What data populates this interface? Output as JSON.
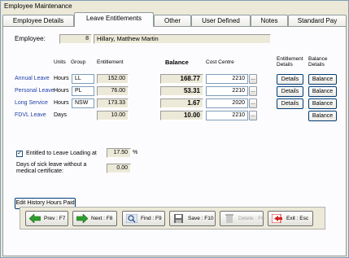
{
  "window": {
    "title": "Employee Maintenance"
  },
  "tabs": [
    "Employee Details",
    "Leave Entitlements",
    "Other",
    "User Defined",
    "Notes",
    "Standard Pay"
  ],
  "employee": {
    "label": "Employee:",
    "number": "8",
    "name": "Hillary, Matthew Martin"
  },
  "headers": {
    "units": "Units",
    "group": "Group",
    "entitlement": "Entitlement",
    "balance": "Balance",
    "cost_centre": "Cost Centre",
    "entitlement_details": "Entitlement Details",
    "balance_details": "Balance Details"
  },
  "leave_rows": [
    {
      "name": "Annual Leave",
      "units": "Hours",
      "group": "LL",
      "entitlement": "152.00",
      "balance": "168.77",
      "cost_centre": "2210",
      "details": "Details",
      "balance_btn": "Balance"
    },
    {
      "name": "Personal Leave",
      "units": "Hours",
      "group": "PL",
      "entitlement": "76.00",
      "balance": "53.31",
      "cost_centre": "2210",
      "details": "Details",
      "balance_btn": "Balance"
    },
    {
      "name": "Long Service",
      "units": "Hours",
      "group": "NSW",
      "entitlement": "173.33",
      "balance": "1.67",
      "cost_centre": "2020",
      "details": "Details",
      "balance_btn": "Balance"
    },
    {
      "name": "FDVL Leave",
      "units": "Days",
      "group": "",
      "entitlement": "10.00",
      "balance": "10.00",
      "cost_centre": "2210",
      "details": "",
      "balance_btn": "Balance"
    }
  ],
  "ellipsis": "...",
  "leave_loading": {
    "label": "Entitled to Leave Loading at",
    "value": "17.50",
    "unit": "%",
    "checked": true
  },
  "sick_leave": {
    "label_line1": "Days of sick leave without a",
    "label_line2": "medical certificate:",
    "value": "0.00"
  },
  "edit_history_button": "Edit History Hours Paid",
  "footer_buttons": [
    {
      "label": "Prev : F7",
      "icon": "arrow-left-icon"
    },
    {
      "label": "Next : F8",
      "icon": "arrow-right-icon"
    },
    {
      "label": "Find : F9",
      "icon": "magnifier-icon"
    },
    {
      "label": "Save : F10",
      "icon": "disk-icon"
    },
    {
      "label": "Delete : F6",
      "icon": "trash-icon"
    },
    {
      "label": "Exit : Esc",
      "icon": "exit-icon"
    }
  ],
  "colors": {
    "link": "#1f3fa8",
    "green_arrow": "#2f9d2f",
    "exit_red": "#d42020"
  }
}
